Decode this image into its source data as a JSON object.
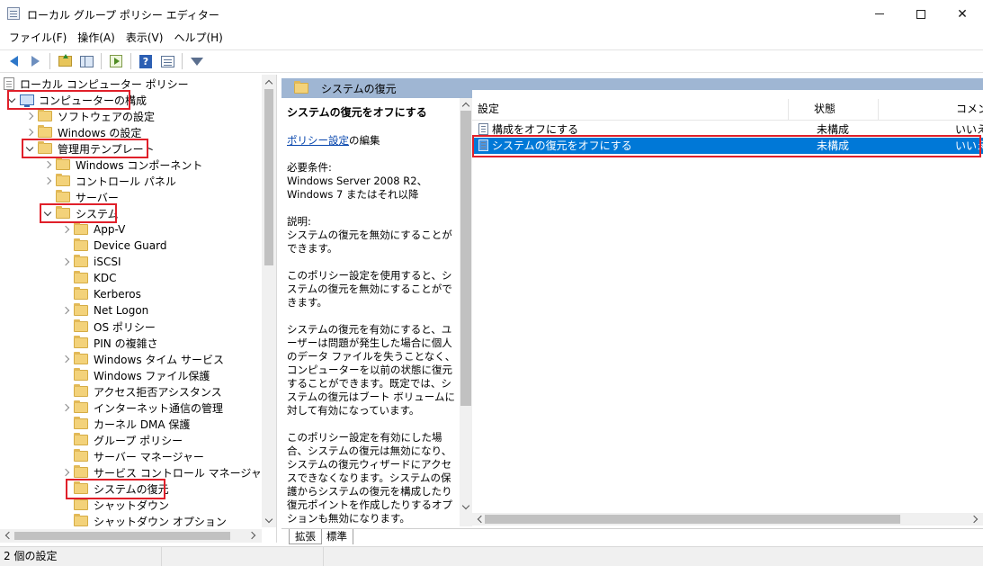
{
  "window": {
    "title": "ローカル グループ ポリシー エディター"
  },
  "menu": [
    "ファイル(F)",
    "操作(A)",
    "表示(V)",
    "ヘルプ(H)"
  ],
  "toolbar": {
    "help_label": "?"
  },
  "tree": {
    "root": "ローカル コンピューター ポリシー",
    "computer_config": "コンピューターの構成",
    "software_settings": "ソフトウェアの設定",
    "windows_settings": "Windows の設定",
    "admin_templates": "管理用テンプレート",
    "admin_children": [
      "Windows コンポーネント",
      "コントロール パネル",
      "サーバー"
    ],
    "system": "システム",
    "system_children": [
      {
        "label": "App-V",
        "expandable": true
      },
      {
        "label": "Device Guard",
        "expandable": false
      },
      {
        "label": "iSCSI",
        "expandable": true
      },
      {
        "label": "KDC",
        "expandable": false
      },
      {
        "label": "Kerberos",
        "expandable": false
      },
      {
        "label": "Net Logon",
        "expandable": true
      },
      {
        "label": "OS ポリシー",
        "expandable": false
      },
      {
        "label": "PIN の複雑さ",
        "expandable": false
      },
      {
        "label": "Windows タイム サービス",
        "expandable": true
      },
      {
        "label": "Windows ファイル保護",
        "expandable": false
      },
      {
        "label": "アクセス拒否アシスタンス",
        "expandable": false
      },
      {
        "label": "インターネット通信の管理",
        "expandable": true
      },
      {
        "label": "カーネル DMA 保護",
        "expandable": false
      },
      {
        "label": "グループ ポリシー",
        "expandable": false
      },
      {
        "label": "サーバー マネージャー",
        "expandable": false
      },
      {
        "label": "サービス コントロール マネージャーの設定",
        "expandable": true
      },
      {
        "label": "システムの復元",
        "expandable": false,
        "selected": true
      },
      {
        "label": "シャットダウン",
        "expandable": false
      },
      {
        "label": "シャットダウン オプション",
        "expandable": false
      }
    ]
  },
  "right_header": "システムの復元",
  "description": {
    "title": "システムの復元をオフにする",
    "edit_link": "ポリシー設定",
    "edit_suffix": "の編集",
    "requirements": "必要条件:\nWindows Server 2008 R2、Windows 7 またはそれ以降",
    "body": "説明:\nシステムの復元を無効にすることができます。\n\nこのポリシー設定を使用すると、システムの復元を無効にすることができます。\n\nシステムの復元を有効にすると、ユーザーは問題が発生した場合に個人のデータ ファイルを失うことなく、コンピューターを以前の状態に復元することができます。既定では、システムの復元はブート ボリュームに対して有効になっています。\n\nこのポリシー設定を有効にした場合、システムの復元は無効になり、システムの復元ウィザードにアクセスできなくなります。システムの保護からシステムの復元を構成したり復元ポイントを作成したりするオプションも無効になります。\n\nこのポリシー設定を無効にした場合、または構成しなかった場合は、ユーザーは"
  },
  "list": {
    "columns": [
      "設定",
      "状態",
      "コメント"
    ],
    "rows": [
      {
        "setting": "構成をオフにする",
        "state": "未構成",
        "comment": "いいえ",
        "selected": false
      },
      {
        "setting": "システムの復元をオフにする",
        "state": "未構成",
        "comment": "いいえ",
        "selected": true
      }
    ]
  },
  "tabs": [
    "拡張",
    "標準"
  ],
  "status": "2 個の設定",
  "colors": {
    "highlight_box": "#e0202a",
    "selection": "#0078d7",
    "header_band": "#9fb6d3"
  }
}
